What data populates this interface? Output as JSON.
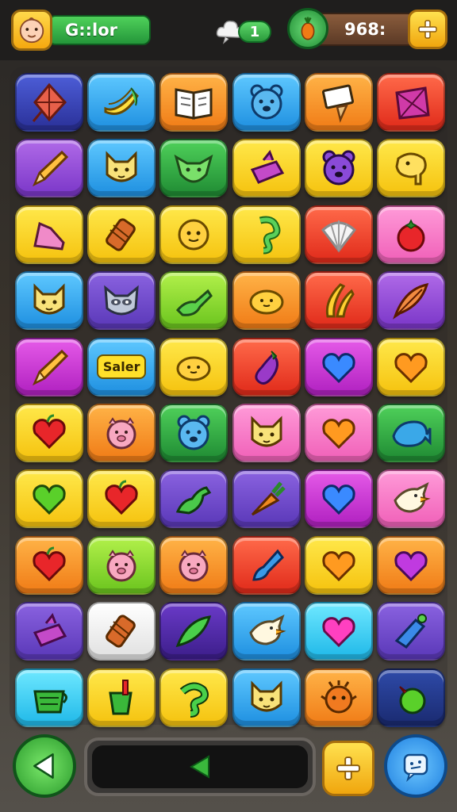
{
  "header": {
    "player_name": "G::lor",
    "lives_value": "1",
    "coin_value": "968:",
    "avatar_icon": "baby-face-icon",
    "cloud_icon": "cloud-icon",
    "fruit_icon": "carrot-icon",
    "plus_icon": "plus-icon"
  },
  "board": {
    "rows": [
      [
        {
          "color": "navy",
          "icon": "kite-icon"
        },
        {
          "color": "blue",
          "icon": "bananas-icon"
        },
        {
          "color": "orange",
          "icon": "book-icon"
        },
        {
          "color": "blue",
          "icon": "bear-face-icon"
        },
        {
          "color": "orange",
          "icon": "notepad-icon"
        },
        {
          "color": "red",
          "icon": "gem-icon"
        }
      ],
      [
        {
          "color": "purple",
          "icon": "pencil-icon"
        },
        {
          "color": "blue",
          "icon": "cat-face-icon"
        },
        {
          "color": "green",
          "icon": "alien-face-icon"
        },
        {
          "color": "yellow",
          "icon": "gift-box-icon"
        },
        {
          "color": "yellow",
          "icon": "purple-bear-icon"
        },
        {
          "color": "yellow",
          "icon": "elephant-icon"
        }
      ],
      [
        {
          "color": "yellow",
          "icon": "shoe-icon"
        },
        {
          "color": "yellow",
          "icon": "rolling-pin-icon"
        },
        {
          "color": "yellow",
          "icon": "smiley-face-icon"
        },
        {
          "color": "yellow",
          "icon": "seahorse-icon"
        },
        {
          "color": "red",
          "icon": "shell-icon"
        },
        {
          "color": "pink",
          "icon": "tomato-icon"
        }
      ],
      [
        {
          "color": "blue",
          "icon": "cat-face-icon"
        },
        {
          "color": "violet",
          "icon": "raccoon-face-icon"
        },
        {
          "color": "lime",
          "icon": "frog-icon"
        },
        {
          "color": "orange",
          "icon": "lemon-face-icon"
        },
        {
          "color": "red",
          "icon": "banana-icon"
        },
        {
          "color": "purple",
          "icon": "feather-icon"
        }
      ],
      [
        {
          "color": "magenta",
          "icon": "pencil-icon"
        },
        {
          "color": "blue",
          "label": "Saler"
        },
        {
          "color": "yellow",
          "icon": "lemon-face-icon"
        },
        {
          "color": "red",
          "icon": "eggplant-icon"
        },
        {
          "color": "magenta",
          "icon": "blue-heart-icon"
        },
        {
          "color": "yellow",
          "icon": "orange-heart-icon"
        }
      ],
      [
        {
          "color": "yellow",
          "icon": "apple-icon"
        },
        {
          "color": "orange",
          "icon": "pig-face-icon"
        },
        {
          "color": "green",
          "icon": "bear-face-icon"
        },
        {
          "color": "pink",
          "icon": "cat-face-icon"
        },
        {
          "color": "pink",
          "icon": "orange-heart-icon"
        },
        {
          "color": "green",
          "icon": "whale-icon"
        }
      ],
      [
        {
          "color": "yellow",
          "icon": "green-heart-icon"
        },
        {
          "color": "yellow",
          "icon": "apple-icon"
        },
        {
          "color": "violet",
          "icon": "dinosaur-icon"
        },
        {
          "color": "violet",
          "icon": "carrot-icon"
        },
        {
          "color": "magenta",
          "icon": "blue-heart-icon"
        },
        {
          "color": "pink",
          "icon": "bird-icon"
        }
      ],
      [
        {
          "color": "orange",
          "icon": "apple-icon"
        },
        {
          "color": "lime",
          "icon": "pig-face-icon"
        },
        {
          "color": "orange",
          "icon": "pig-face-icon"
        },
        {
          "color": "red",
          "icon": "paint-brush-icon"
        },
        {
          "color": "yellow",
          "icon": "orange-heart-icon"
        },
        {
          "color": "orange",
          "icon": "purple-heart-icon"
        }
      ],
      [
        {
          "color": "violet",
          "icon": "gift-box-icon"
        },
        {
          "color": "white",
          "icon": "rolling-pin-icon"
        },
        {
          "color": "darkpurple",
          "icon": "leaf-icon"
        },
        {
          "color": "blue",
          "icon": "bird-icon"
        },
        {
          "color": "cyan",
          "icon": "pink-heart-icon"
        },
        {
          "color": "violet",
          "icon": "water-gun-icon"
        }
      ],
      [
        {
          "color": "cyan",
          "icon": "bucket-icon"
        },
        {
          "color": "yellow",
          "icon": "soda-cup-icon"
        },
        {
          "color": "yellow",
          "icon": "snake-icon"
        },
        {
          "color": "blue",
          "icon": "cat-face-icon"
        },
        {
          "color": "orange",
          "icon": "monster-face-icon"
        },
        {
          "color": "darkblue",
          "icon": "green-apple-icon"
        }
      ]
    ]
  },
  "footer": {
    "back_icon": "back-arrow-icon",
    "progress_icon": "play-left-icon",
    "add_icon": "plus-icon",
    "chat_icon": "chat-icon"
  },
  "colors": {
    "topbar": "#1f1e1d",
    "accent_green": "#2a9a3c",
    "accent_yellow": "#f5c20e"
  }
}
